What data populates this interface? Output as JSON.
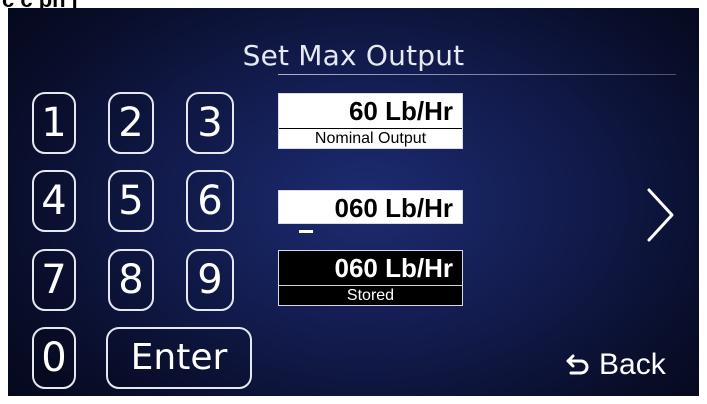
{
  "screen": {
    "title": "Set Max Output",
    "keypad": {
      "keys": [
        "1",
        "2",
        "3",
        "4",
        "5",
        "6",
        "7",
        "8",
        "9",
        "0"
      ],
      "enter_label": "Enter"
    },
    "nominal": {
      "value": "60 Lb/Hr",
      "caption": "Nominal Output"
    },
    "entry": {
      "value": "060 Lb/Hr"
    },
    "stored": {
      "value": "060 Lb/Hr",
      "caption": "Stored"
    },
    "navigation": {
      "next_icon": "chevron-right-icon",
      "back_icon": "undo-arrow-icon",
      "back_label": "Back"
    },
    "colors": {
      "screen_background": "#111a4a",
      "text": "#ffffff",
      "stored_panel": "#000000"
    }
  }
}
